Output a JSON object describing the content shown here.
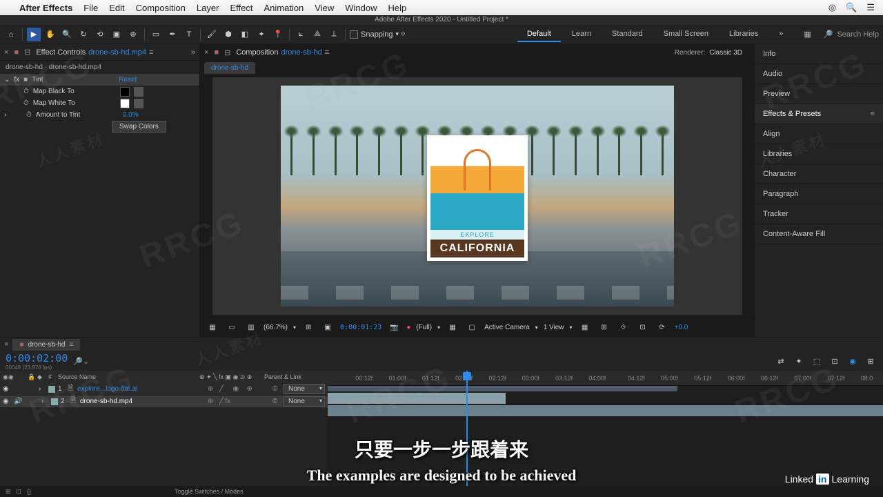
{
  "mac_menu": {
    "apple": "",
    "app": "After Effects",
    "items": [
      "File",
      "Edit",
      "Composition",
      "Layer",
      "Effect",
      "Animation",
      "View",
      "Window",
      "Help"
    ]
  },
  "title_bar": "Adobe After Effects 2020 - Untitled Project *",
  "toolbar": {
    "snapping": "Snapping",
    "workspaces": [
      "Default",
      "Learn",
      "Standard",
      "Small Screen",
      "Libraries"
    ],
    "active_workspace": "Default",
    "search_placeholder": "Search Help"
  },
  "effect_controls": {
    "tab_label": "Effect Controls",
    "source": "drone-sb-hd.mp4",
    "breadcrumb": "drone-sb-hd · drone-sb-hd.mp4",
    "fx_name": "Tint",
    "reset": "Reset",
    "map_black": "Map Black To",
    "map_white": "Map White To",
    "amount_label": "Amount to Tint",
    "amount_value": "0.0%",
    "swap": "Swap Colors"
  },
  "composition": {
    "tab_label": "Composition",
    "source": "drone-sb-hd",
    "name": "drone-sb-hd",
    "renderer_label": "Renderer:",
    "renderer_value": "Classic 3D"
  },
  "logo": {
    "explore": "EXPLORE",
    "california": "CALIFORNIA"
  },
  "viewer_controls": {
    "zoom": "(66.7%)",
    "time": "0:00:01:23",
    "resolution": "(Full)",
    "camera": "Active Camera",
    "views": "1 View",
    "exposure": "+0.0"
  },
  "side_panels": [
    "Info",
    "Audio",
    "Preview",
    "Effects & Presets",
    "Align",
    "Libraries",
    "Character",
    "Paragraph",
    "Tracker",
    "Content-Aware Fill"
  ],
  "side_active": "Effects & Presets",
  "timeline": {
    "tab": "drone-sb-hd",
    "timecode": "0:00:02:00",
    "frames": "00048 (23.976 fps)",
    "col_num": "#",
    "col_source": "Source Name",
    "col_parent": "Parent & Link",
    "layers": [
      {
        "n": "1",
        "name": "explore...logo-flat.ai",
        "parent": "None"
      },
      {
        "n": "2",
        "name": "drone-sb-hd.mp4",
        "parent": "None"
      }
    ],
    "ruler": [
      "00:12f",
      "01:00f",
      "01:12f",
      "02:00f",
      "02:12f",
      "03:00f",
      "03:12f",
      "04:00f",
      "04:12f",
      "05:00f",
      "05:12f",
      "06:00f",
      "06:12f",
      "07:00f",
      "07:12f",
      "08:0"
    ],
    "toggle": "Toggle Switches / Modes"
  },
  "subtitle_cn": "只要一步一步跟着来",
  "subtitle_en": "The examples are designed to be achieved",
  "linkedin": {
    "brand": "Linked",
    "in": "in",
    "learning": "Learning"
  }
}
